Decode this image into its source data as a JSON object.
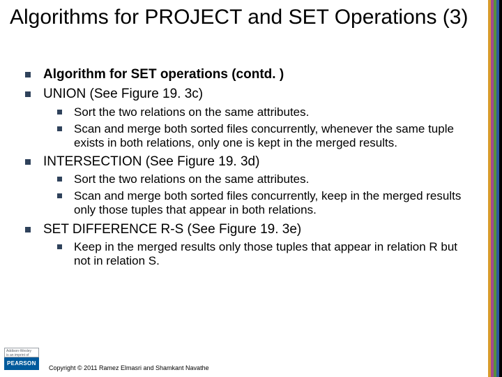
{
  "title": "Algorithms for PROJECT and SET Operations (3)",
  "bullets": {
    "a": "Algorithm for SET operations (contd. )",
    "b": "UNION (See Figure 19. 3c)",
    "b1": "Sort the two relations on the same attributes.",
    "b2": "Scan and merge both sorted files concurrently, whenever the same tuple exists in both relations, only one is kept in the merged results.",
    "c": "INTERSECTION (See Figure 19. 3d)",
    "c1": "Sort the two relations on the same attributes.",
    "c2": "Scan and merge both sorted files concurrently, keep in the merged results only those tuples that appear in both relations.",
    "d": "SET DIFFERENCE R-S (See Figure 19. 3e)",
    "d1": "Keep in the merged results only those tuples that appear in relation R but not in relation S."
  },
  "logo": {
    "top": "Addison-Wesley\nis an imprint of",
    "bottom": "PEARSON"
  },
  "footer": "Copyright © 2011 Ramez Elmasri and Shamkant Navathe"
}
